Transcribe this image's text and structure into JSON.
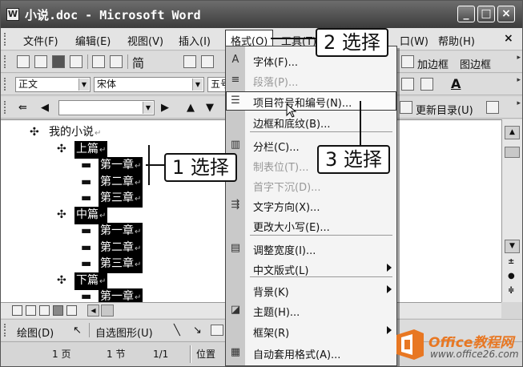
{
  "window": {
    "title": "小说.doc - Microsoft Word",
    "icon_glyph": "W",
    "minimize": "_",
    "maximize": "□",
    "close": "×"
  },
  "menubar": {
    "items": [
      "文件(F)",
      "编辑(E)",
      "视图(V)",
      "插入(I)",
      "格式(O)",
      "工具(T)",
      "口(W)",
      "帮助(H)"
    ],
    "close": "×"
  },
  "toolbar1": {
    "font_size_icon": "简",
    "add_border": "加边框",
    "picture_border": "图边框"
  },
  "toolbar2": {
    "style": "正文",
    "font": "宋体",
    "size": "五号",
    "font_color_letter": "A"
  },
  "toolbar3": {
    "update_toc": "更新目录(U)"
  },
  "document": {
    "nodes": [
      {
        "sym": "✣",
        "text": "我的小说",
        "selected": false
      },
      {
        "sym": "✣",
        "text": "上篇",
        "selected": true
      },
      {
        "sym": "▬",
        "text": "第一章",
        "selected": true
      },
      {
        "sym": "▬",
        "text": "第二章",
        "selected": true
      },
      {
        "sym": "▬",
        "text": "第三章",
        "selected": true
      },
      {
        "sym": "✣",
        "text": "中篇",
        "selected": true
      },
      {
        "sym": "▬",
        "text": "第一章",
        "selected": true
      },
      {
        "sym": "▬",
        "text": "第二章",
        "selected": true
      },
      {
        "sym": "▬",
        "text": "第三章",
        "selected": true
      },
      {
        "sym": "✣",
        "text": "下篇",
        "selected": true
      },
      {
        "sym": "▬",
        "text": "第一章",
        "selected": true
      }
    ],
    "para_mark": "↵"
  },
  "format_menu": {
    "items": [
      {
        "label": "字体(F)...",
        "icon": "A",
        "disabled": false,
        "submenu": false
      },
      {
        "label": "段落(P)...",
        "icon": "≡",
        "disabled": true,
        "submenu": false
      },
      {
        "label": "项目符号和编号(N)...",
        "icon": "☰",
        "disabled": false,
        "submenu": false,
        "highlighted": true
      },
      {
        "label": "边框和底纹(B)...",
        "icon": "",
        "disabled": false,
        "submenu": false
      },
      {
        "label": "分栏(C)...",
        "icon": "▥",
        "disabled": false,
        "submenu": false
      },
      {
        "label": "制表位(T)...",
        "icon": "",
        "disabled": true,
        "submenu": false
      },
      {
        "label": "首字下沉(D)...",
        "icon": "",
        "disabled": true,
        "submenu": false
      },
      {
        "label": "文字方向(X)...",
        "icon": "⇶",
        "disabled": false,
        "submenu": false
      },
      {
        "label": "更改大小写(E)...",
        "icon": "",
        "disabled": false,
        "submenu": false
      },
      {
        "label": "调整宽度(I)...",
        "icon": "▤",
        "disabled": false,
        "submenu": false
      },
      {
        "label": "中文版式(L)",
        "icon": "",
        "disabled": false,
        "submenu": true
      },
      {
        "label": "背景(K)",
        "icon": "",
        "disabled": false,
        "submenu": true
      },
      {
        "label": "主题(H)...",
        "icon": "◪",
        "disabled": false,
        "submenu": false
      },
      {
        "label": "框架(R)",
        "icon": "",
        "disabled": false,
        "submenu": true
      },
      {
        "label": "自动套用格式(A)...",
        "icon": "▦",
        "disabled": false,
        "submenu": false
      }
    ]
  },
  "callouts": {
    "step1": "1 选择",
    "step2": "2 选择",
    "step3": "3 选择"
  },
  "drawbar": {
    "draw": "绘图(D)",
    "autoshapes": "自选图形(U)"
  },
  "statusbar": {
    "page": "1 页",
    "section": "1 节",
    "page_of": "1/1",
    "position": "位置"
  },
  "watermark": {
    "name": "Office教程网",
    "url": "www.office26.com"
  }
}
